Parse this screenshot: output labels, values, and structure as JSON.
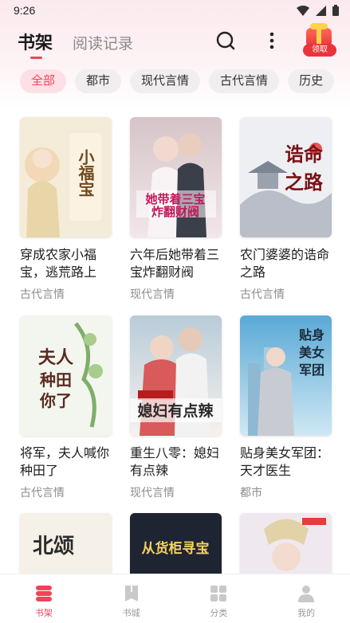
{
  "status": {
    "time": "9:26"
  },
  "header": {
    "tab_shelf": "书架",
    "tab_history": "阅读记录",
    "gift_label": "领取",
    "gift_icon_text": "券"
  },
  "categories": [
    "全部",
    "都市",
    "现代言情",
    "古代言情",
    "历史"
  ],
  "books": [
    {
      "title": "穿成农家小福宝，逃荒路上",
      "genre": "古代言情",
      "cover_text": "穿成农家小福宝"
    },
    {
      "title": "六年后她带着三宝炸翻财阀",
      "genre": "现代言情",
      "cover_text": "她带着三宝炸翻财阀"
    },
    {
      "title": "农门婆婆的诰命之路",
      "genre": "古代言情",
      "cover_text": "诰命之路"
    },
    {
      "title": "将军，夫人喊你种田了",
      "genre": "古代言情",
      "cover_text": "夫人喊你种田了"
    },
    {
      "title": "重生八零：媳妇有点辣",
      "genre": "现代言情",
      "cover_text": "媳妇有点辣"
    },
    {
      "title": "贴身美女军团：天才医生",
      "genre": "都市",
      "cover_text": "贴身美女军团"
    },
    {
      "title": "",
      "genre": "",
      "cover_text": "北颂"
    },
    {
      "title": "",
      "genre": "",
      "cover_text": "从货柜寻宝"
    },
    {
      "title": "",
      "genre": "",
      "cover_text": ""
    }
  ],
  "nav": [
    {
      "label": "书架",
      "icon": "bookshelf-icon"
    },
    {
      "label": "书城",
      "icon": "bookstore-icon"
    },
    {
      "label": "分类",
      "icon": "category-icon"
    },
    {
      "label": "我的",
      "icon": "profile-icon"
    }
  ],
  "colors": {
    "accent": "#f0445a",
    "chip_bg": "#f1eef0",
    "chip_active_bg": "#fde0e5"
  }
}
